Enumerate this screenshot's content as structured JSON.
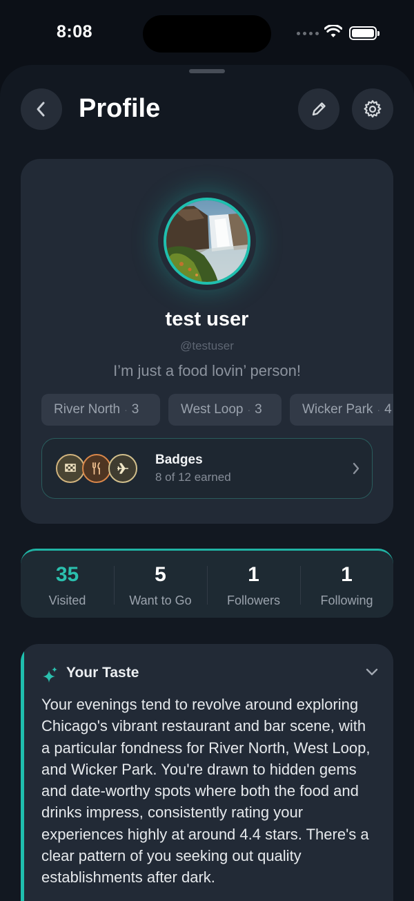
{
  "status": {
    "time": "8:08"
  },
  "header": {
    "title": "Profile"
  },
  "profile": {
    "name": "test user",
    "handle": "@testuser",
    "bio": "I’m just a food lovin’ person!",
    "neighborhoods": [
      {
        "label": "River North",
        "count": "3"
      },
      {
        "label": "West Loop",
        "count": "3"
      },
      {
        "label": "Wicker Park",
        "count": "4"
      }
    ]
  },
  "badges": {
    "title": "Badges",
    "subtitle": "8 of 12 earned",
    "icons": [
      "checkered-flag-icon",
      "utensils-icon",
      "airplane-icon"
    ]
  },
  "stats": [
    {
      "value": "35",
      "label": "Visited"
    },
    {
      "value": "5",
      "label": "Want to Go"
    },
    {
      "value": "1",
      "label": "Followers"
    },
    {
      "value": "1",
      "label": "Following"
    }
  ],
  "taste": {
    "title": "Your Taste",
    "text": "Your evenings tend to revolve around exploring Chicago's vibrant restaurant and bar scene, with a particular fondness for River North, West Loop, and Wicker Park. You're drawn to hidden gems and date-worthy spots where both the food and drinks impress, consistently rating your experiences highly at around 4.4 stars. There's a clear pattern of you seeking out quality establishments after dark."
  },
  "colors": {
    "accent": "#1fbfae",
    "background": "#121821",
    "card": "#222a36"
  }
}
